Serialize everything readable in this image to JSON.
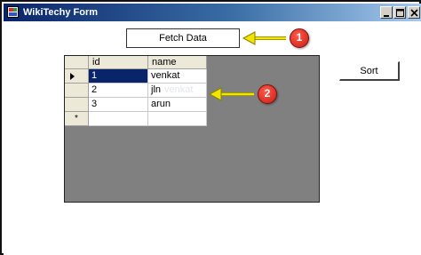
{
  "window": {
    "title": "WikiTechy Form",
    "controls": [
      "minimize",
      "maximize",
      "close"
    ]
  },
  "buttons": {
    "fetch_label": "Fetch Data",
    "sort_label": "Sort"
  },
  "grid": {
    "columns": [
      "id",
      "name"
    ],
    "rows": [
      {
        "id": "1",
        "name": "venkat",
        "selected_id": true
      },
      {
        "id": "2",
        "name": "jln",
        "ghost": "venkat"
      },
      {
        "id": "3",
        "name": "arun"
      }
    ],
    "new_row_marker": "*"
  },
  "annotations": [
    {
      "number": "1",
      "target": "fetch-data-button"
    },
    {
      "number": "2",
      "target": "data-grid"
    }
  ],
  "colors": {
    "titlebar_start": "#0a246a",
    "titlebar_end": "#a6caf0",
    "grid_background": "#808080",
    "selection": "#0a246a",
    "callout_red": "#d9261c",
    "arrow_yellow": "#f2e600"
  }
}
